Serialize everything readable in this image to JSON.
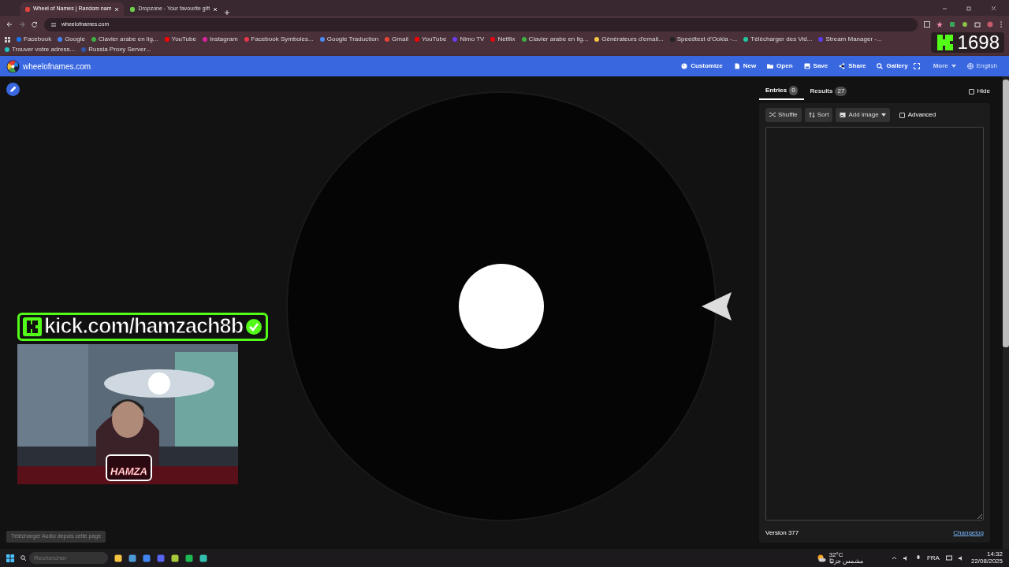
{
  "browser": {
    "tabs": [
      {
        "title": "Wheel of Names | Random nam",
        "selected": true,
        "color": "#e0463c"
      },
      {
        "title": "Dropzone - Your favourite gift",
        "selected": false,
        "color": "#6ad04a"
      }
    ],
    "address": "wheelofnames.com",
    "bookmarks": [
      {
        "label": "Facebook",
        "color": "#1877f2"
      },
      {
        "label": "Google",
        "color": "#4285f4"
      },
      {
        "label": "Clavier arabe en lig...",
        "color": "#3cb043"
      },
      {
        "label": "YouTube",
        "color": "#ff0000"
      },
      {
        "label": "Instagram",
        "color": "#d6249f"
      },
      {
        "label": "Facebook Symboles...",
        "color": "#e8334a"
      },
      {
        "label": "Google Traduction",
        "color": "#4c8bf5"
      },
      {
        "label": "Gmail",
        "color": "#ea4335"
      },
      {
        "label": "YouTube",
        "color": "#ff0000"
      },
      {
        "label": "Nimo TV",
        "color": "#6c3cf0"
      },
      {
        "label": "Netflix",
        "color": "#e50914"
      },
      {
        "label": "Clavier arabe en lig...",
        "color": "#3cb043"
      },
      {
        "label": "Générateurs d'email...",
        "color": "#f4c542"
      },
      {
        "label": "Speedtest d'Ookla -...",
        "color": "#222222"
      },
      {
        "label": "Télécharger des Vid...",
        "color": "#22c7a0"
      },
      {
        "label": "Stream Manager -...",
        "color": "#5b3cf0"
      },
      {
        "label": "Trouver votre adress...",
        "color": "#25c0c0"
      },
      {
        "label": "Russia Proxy Server...",
        "color": "#3355aa"
      }
    ]
  },
  "app": {
    "site_title": "wheelofnames.com",
    "menu": [
      {
        "label": "Customize"
      },
      {
        "label": "New"
      },
      {
        "label": "Open"
      },
      {
        "label": "Save"
      },
      {
        "label": "Share"
      },
      {
        "label": "Gallery"
      }
    ],
    "more": "More",
    "language": "English",
    "panel": {
      "tabs": [
        {
          "label": "Entries",
          "count": "0",
          "selected": true
        },
        {
          "label": "Results",
          "count": "27",
          "selected": false
        }
      ],
      "hide": {
        "label": "Hide",
        "checked": false
      },
      "tools": [
        {
          "label": "Shuffle"
        },
        {
          "label": "Sort"
        },
        {
          "label": "Add image",
          "dropdown": true
        }
      ],
      "advanced": {
        "label": "Advanced",
        "checked": false
      },
      "version": "Version 377",
      "changelog": "Changelog"
    }
  },
  "overlay": {
    "channel": "kick.com/hamzach8b",
    "logo_text": "HAMZA",
    "counter": "1698",
    "download_bar": "Télécharger Audio depuis cette page"
  },
  "taskbar": {
    "search_placeholder": "Rechercher",
    "temperature": "32°C",
    "weather": "مشمس جزئيًا",
    "language": "FRA",
    "time": "14:32",
    "date": "22/08/2025"
  }
}
